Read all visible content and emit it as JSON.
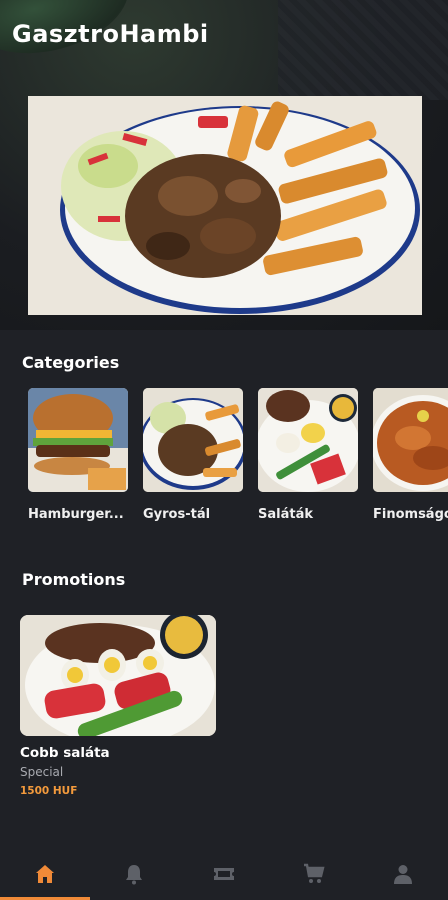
{
  "app": {
    "title": "GasztroHambi"
  },
  "sections": {
    "categories_title": "Categories",
    "promotions_title": "Promotions"
  },
  "categories": [
    {
      "label": "Hamburger..."
    },
    {
      "label": "Gyros-tál"
    },
    {
      "label": "Saláták"
    },
    {
      "label": "Finomságok"
    }
  ],
  "promotion": {
    "name": "Cobb saláta",
    "subtitle": "Special",
    "price": "1500 HUF"
  },
  "nav": {
    "items": [
      {
        "icon": "home-icon",
        "active": true
      },
      {
        "icon": "bell-icon",
        "active": false
      },
      {
        "icon": "ticket-icon",
        "active": false
      },
      {
        "icon": "cart-icon",
        "active": false
      },
      {
        "icon": "user-icon",
        "active": false
      }
    ]
  },
  "colors": {
    "accent": "#f08a38",
    "background": "#1f2126",
    "price": "#f39a3c",
    "inactive_icon": "#5e6168"
  }
}
